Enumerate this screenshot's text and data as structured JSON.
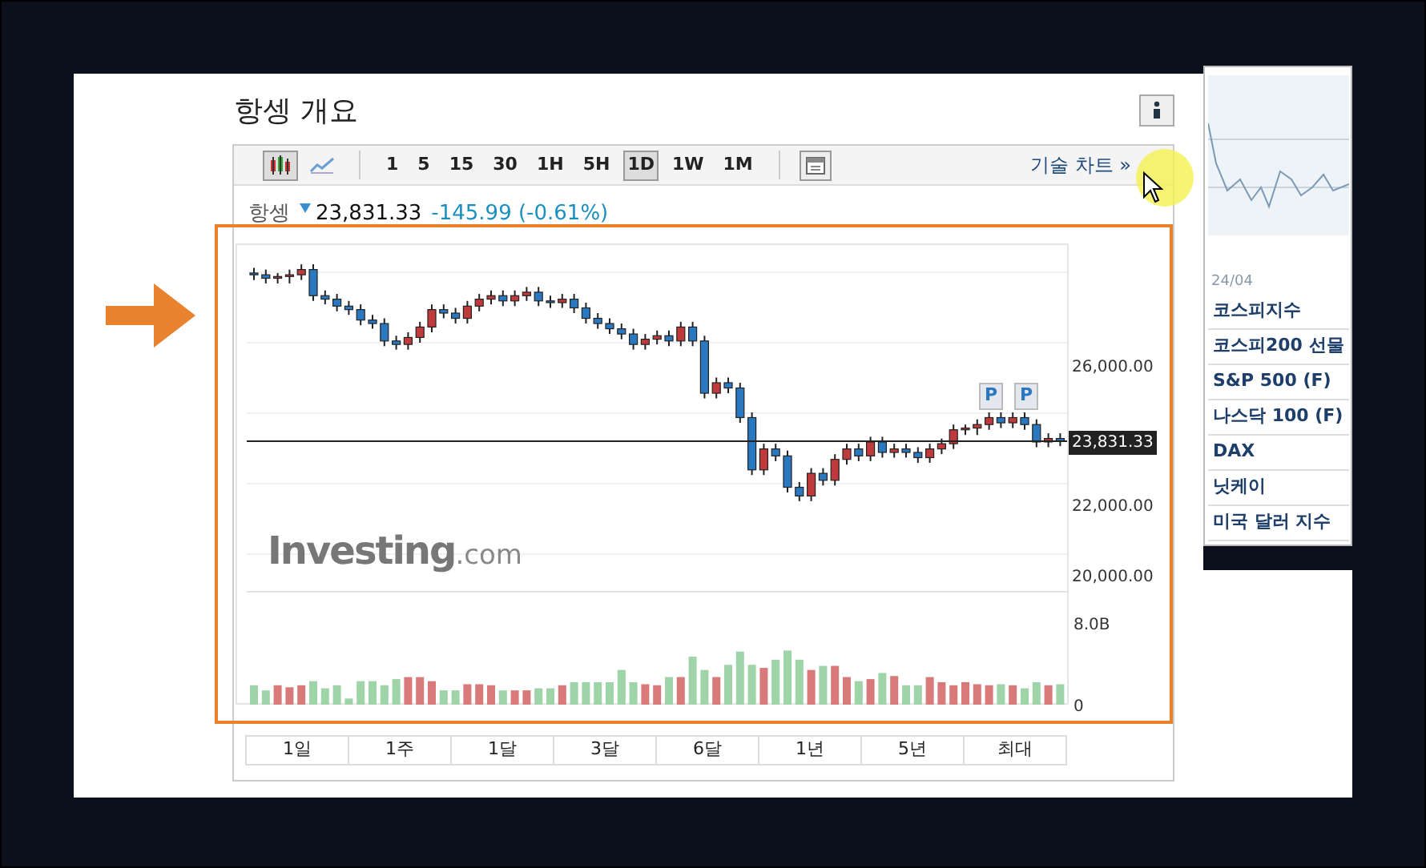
{
  "page_title": "항셍 개요",
  "toolbar": {
    "chart_types": [
      {
        "kind": "candle",
        "selected": true
      },
      {
        "kind": "line",
        "selected": false
      }
    ],
    "intervals": [
      {
        "label": "1",
        "selected": false
      },
      {
        "label": "5",
        "selected": false
      },
      {
        "label": "15",
        "selected": false
      },
      {
        "label": "30",
        "selected": false
      },
      {
        "label": "1H",
        "selected": false
      },
      {
        "label": "5H",
        "selected": false
      },
      {
        "label": "1D",
        "selected": true
      },
      {
        "label": "1W",
        "selected": false
      },
      {
        "label": "1M",
        "selected": false
      }
    ],
    "tech_chart_link": "기술 차트 »"
  },
  "quote": {
    "name": "항셍",
    "price": "23,831.33",
    "change": "-145.99 (-0.61%)"
  },
  "chart": {
    "chart_data": {
      "type": "candlestick",
      "ylim": [
        19500,
        29500
      ],
      "yticks": [
        {
          "value": 26000,
          "label": "26,000.00"
        },
        {
          "value": 22000,
          "label": "22,000.00"
        },
        {
          "value": 20000,
          "label": "20,000.00"
        }
      ],
      "ohlc": [
        [
          28650,
          28800,
          28450,
          28600
        ],
        [
          28600,
          28750,
          28350,
          28500
        ],
        [
          28500,
          28650,
          28350,
          28550
        ],
        [
          28550,
          28750,
          28350,
          28600
        ],
        [
          28600,
          28900,
          28450,
          28750
        ],
        [
          28750,
          28900,
          27850,
          28000
        ],
        [
          28000,
          28150,
          27750,
          27900
        ],
        [
          27900,
          28050,
          27550,
          27700
        ],
        [
          27700,
          27850,
          27450,
          27600
        ],
        [
          27600,
          27750,
          27150,
          27300
        ],
        [
          27300,
          27450,
          27050,
          27200
        ],
        [
          27200,
          27350,
          26550,
          26700
        ],
        [
          26700,
          26850,
          26450,
          26600
        ],
        [
          26600,
          26950,
          26450,
          26800
        ],
        [
          26800,
          27250,
          26650,
          27100
        ],
        [
          27100,
          27750,
          26950,
          27600
        ],
        [
          27600,
          27750,
          27350,
          27500
        ],
        [
          27500,
          27650,
          27200,
          27350
        ],
        [
          27350,
          27850,
          27200,
          27700
        ],
        [
          27700,
          28050,
          27550,
          27900
        ],
        [
          27900,
          28150,
          27750,
          28000
        ],
        [
          28000,
          28150,
          27700,
          27850
        ],
        [
          27850,
          28150,
          27700,
          28000
        ],
        [
          28000,
          28250,
          27850,
          28100
        ],
        [
          28100,
          28250,
          27700,
          27850
        ],
        [
          27850,
          28000,
          27650,
          27800
        ],
        [
          27800,
          28050,
          27650,
          27900
        ],
        [
          27900,
          28050,
          27500,
          27650
        ],
        [
          27650,
          27800,
          27200,
          27350
        ],
        [
          27350,
          27500,
          27050,
          27200
        ],
        [
          27200,
          27350,
          26900,
          27050
        ],
        [
          27050,
          27200,
          26750,
          26900
        ],
        [
          26900,
          27050,
          26450,
          26600
        ],
        [
          26600,
          26900,
          26450,
          26750
        ],
        [
          26750,
          27000,
          26600,
          26850
        ],
        [
          26850,
          27000,
          26550,
          26700
        ],
        [
          26700,
          27250,
          26550,
          27100
        ],
        [
          27100,
          27250,
          26550,
          26700
        ],
        [
          26700,
          26850,
          25050,
          25200
        ],
        [
          25200,
          25650,
          25050,
          25500
        ],
        [
          25500,
          25650,
          25200,
          25350
        ],
        [
          25350,
          25500,
          24350,
          24500
        ],
        [
          24500,
          24650,
          22850,
          23000
        ],
        [
          23000,
          23750,
          22850,
          23600
        ],
        [
          23600,
          23750,
          23250,
          23400
        ],
        [
          23400,
          23550,
          22350,
          22500
        ],
        [
          22500,
          22650,
          22100,
          22250
        ],
        [
          22250,
          23050,
          22100,
          22900
        ],
        [
          22900,
          23050,
          22550,
          22700
        ],
        [
          22700,
          23450,
          22550,
          23300
        ],
        [
          23300,
          23750,
          23150,
          23600
        ],
        [
          23600,
          23750,
          23250,
          23400
        ],
        [
          23400,
          23950,
          23250,
          23800
        ],
        [
          23800,
          23950,
          23350,
          23500
        ],
        [
          23500,
          23750,
          23350,
          23600
        ],
        [
          23600,
          23750,
          23350,
          23500
        ],
        [
          23500,
          23650,
          23200,
          23350
        ],
        [
          23350,
          23750,
          23200,
          23600
        ],
        [
          23600,
          23900,
          23450,
          23750
        ],
        [
          23750,
          24300,
          23600,
          24150
        ],
        [
          24150,
          24300,
          24000,
          24200
        ],
        [
          24200,
          24450,
          24000,
          24300
        ],
        [
          24300,
          24650,
          24150,
          24500
        ],
        [
          24500,
          24650,
          24200,
          24350
        ],
        [
          24350,
          24650,
          24200,
          24500
        ],
        [
          24500,
          24650,
          24150,
          24300
        ],
        [
          24300,
          24450,
          23650,
          23800
        ],
        [
          23800,
          24050,
          23650,
          23900
        ],
        [
          23900,
          24050,
          23681,
          23831
        ]
      ]
    },
    "current_price_label": "23,831.33",
    "logo": {
      "brand": "Investing",
      "suffix": ".com"
    },
    "markers": [
      "P",
      "P"
    ]
  },
  "volume": {
    "chart_data": {
      "type": "bar",
      "ylim": [
        0,
        8
      ],
      "yticks": [
        {
          "value": 8,
          "label": "8.0B"
        },
        {
          "value": 0,
          "label": "0"
        }
      ],
      "values": [
        1.9,
        1.4,
        1.9,
        1.7,
        1.9,
        2.3,
        1.6,
        1.9,
        0.6,
        2.3,
        2.3,
        1.9,
        2.5,
        2.7,
        2.7,
        2.3,
        1.4,
        1.4,
        2.0,
        2.0,
        1.9,
        1.4,
        1.4,
        1.4,
        1.6,
        1.6,
        1.9,
        2.2,
        2.2,
        2.2,
        2.2,
        3.4,
        2.2,
        2.0,
        1.9,
        2.7,
        2.7,
        4.7,
        3.4,
        2.7,
        3.9,
        5.2,
        3.9,
        3.6,
        4.4,
        5.3,
        4.4,
        3.4,
        3.8,
        3.8,
        2.7,
        2.3,
        2.5,
        3.1,
        2.8,
        1.9,
        1.9,
        2.7,
        2.2,
        1.9,
        2.2,
        2.0,
        1.9,
        2.0,
        1.9,
        1.6,
        2.2,
        1.9,
        2.0
      ]
    }
  },
  "ranges": [
    {
      "label": "1일"
    },
    {
      "label": "1주"
    },
    {
      "label": "1달"
    },
    {
      "label": "3달"
    },
    {
      "label": "6달"
    },
    {
      "label": "1년"
    },
    {
      "label": "5년"
    },
    {
      "label": "최대"
    }
  ],
  "sidebar": {
    "mini_chart_date": "24/04",
    "items": [
      "코스피지수",
      "코스피200 선물",
      "S&P 500 (F)",
      "나스닥 100 (F)",
      "DAX",
      "닛케이",
      "미국 달러 지수"
    ]
  }
}
